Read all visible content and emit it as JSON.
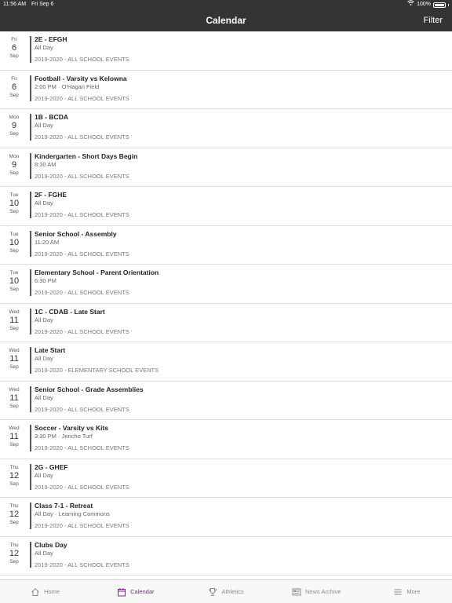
{
  "status": {
    "time": "11:56 AM",
    "date": "Fri Sep 6",
    "battery": "100%"
  },
  "header": {
    "title": "Calendar",
    "filter_label": "Filter"
  },
  "events": [
    {
      "dow": "Fri",
      "day": "6",
      "mon": "Sep",
      "title": "2E - EFGH",
      "sub": "All Day",
      "cat": "2019-2020 - ALL SCHOOL EVENTS"
    },
    {
      "dow": "Fri",
      "day": "6",
      "mon": "Sep",
      "title": "Football - Varsity vs Kelowna",
      "sub": "2:00 PM · O'Hagan Field",
      "cat": "2019-2020 - ALL SCHOOL EVENTS"
    },
    {
      "dow": "Mon",
      "day": "9",
      "mon": "Sep",
      "title": "1B - BCDA",
      "sub": "All Day",
      "cat": "2019-2020 - ALL SCHOOL EVENTS"
    },
    {
      "dow": "Mon",
      "day": "9",
      "mon": "Sep",
      "title": "Kindergarten - Short Days Begin",
      "sub": "8:30 AM",
      "cat": "2019-2020 - ALL SCHOOL EVENTS"
    },
    {
      "dow": "Tue",
      "day": "10",
      "mon": "Sep",
      "title": "2F - FGHE",
      "sub": "All Day",
      "cat": "2019-2020 - ALL SCHOOL EVENTS"
    },
    {
      "dow": "Tue",
      "day": "10",
      "mon": "Sep",
      "title": "Senior School - Assembly",
      "sub": "11:20 AM",
      "cat": "2019-2020 - ALL SCHOOL EVENTS"
    },
    {
      "dow": "Tue",
      "day": "10",
      "mon": "Sep",
      "title": "Elementary School - Parent Orientation",
      "sub": "6:30 PM",
      "cat": "2019-2020 - ALL SCHOOL EVENTS"
    },
    {
      "dow": "Wed",
      "day": "11",
      "mon": "Sep",
      "title": "1C - CDAB - Late Start",
      "sub": "All Day",
      "cat": "2019-2020 - ALL SCHOOL EVENTS"
    },
    {
      "dow": "Wed",
      "day": "11",
      "mon": "Sep",
      "title": "Late Start",
      "sub": "All Day",
      "cat": "2019-2020 - ELEMENTARY SCHOOL EVENTS"
    },
    {
      "dow": "Wed",
      "day": "11",
      "mon": "Sep",
      "title": "Senior School - Grade Assemblies",
      "sub": "All Day",
      "cat": "2019-2020 - ALL SCHOOL EVENTS"
    },
    {
      "dow": "Wed",
      "day": "11",
      "mon": "Sep",
      "title": "Soccer - Varsity vs Kits",
      "sub": "3:30 PM · Jericho Turf",
      "cat": "2019-2020 - ALL SCHOOL EVENTS"
    },
    {
      "dow": "Thu",
      "day": "12",
      "mon": "Sep",
      "title": "2G - GHEF",
      "sub": "All Day",
      "cat": "2019-2020 - ALL SCHOOL EVENTS"
    },
    {
      "dow": "Thu",
      "day": "12",
      "mon": "Sep",
      "title": "Class 7-1 - Retreat",
      "sub": "All Day · Learning Commons",
      "cat": "2019-2020 - ALL SCHOOL EVENTS"
    },
    {
      "dow": "Thu",
      "day": "12",
      "mon": "Sep",
      "title": "Clubs Day",
      "sub": "All Day",
      "cat": "2019-2020 - ALL SCHOOL EVENTS"
    }
  ],
  "tabs": [
    {
      "label": "Home",
      "icon": "home-icon"
    },
    {
      "label": "Calendar",
      "icon": "calendar-icon"
    },
    {
      "label": "Athletics",
      "icon": "trophy-icon"
    },
    {
      "label": "News Archive",
      "icon": "news-icon"
    },
    {
      "label": "More",
      "icon": "menu-icon"
    }
  ],
  "colors": {
    "header_bg": "#343434",
    "accent": "#6b2f74"
  }
}
